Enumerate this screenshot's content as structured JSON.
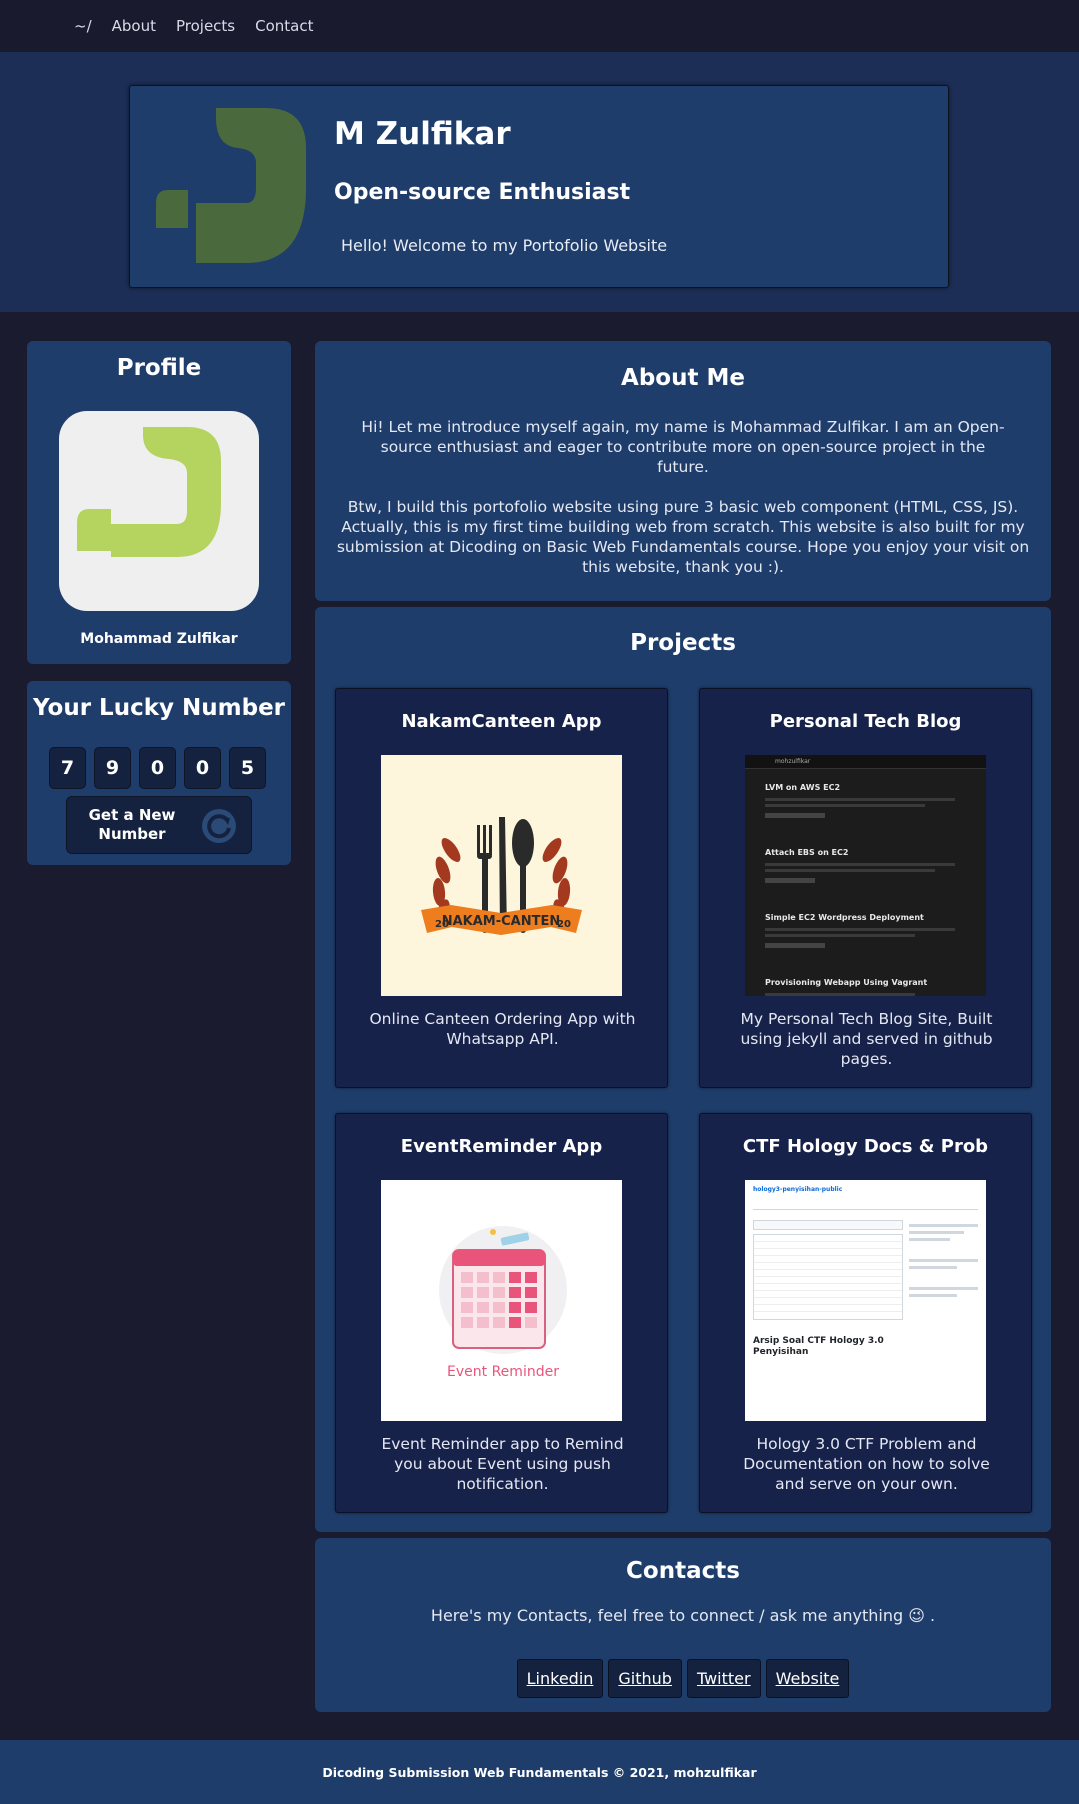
{
  "nav": {
    "home": "~/",
    "about": "About",
    "projects": "Projects",
    "contact": "Contact"
  },
  "hero": {
    "name": "M Zulfikar",
    "subtitle": "Open-source Enthusiast",
    "message": "Hello! Welcome to my Portofolio Website"
  },
  "profile": {
    "title": "Profile",
    "name": "Mohammad Zulfikar"
  },
  "lucky": {
    "title": "Your Lucky Number",
    "digits": [
      "7",
      "9",
      "0",
      "0",
      "5"
    ],
    "button_label": "Get a New Number"
  },
  "about": {
    "title": "About Me",
    "p1": "Hi! Let me introduce myself again, my name is Mohammad Zulfikar. I am an Open-source enthusiast and eager to contribute more on open-source project in the future.",
    "p2": "Btw, I build this portofolio website using pure 3 basic web component (HTML, CSS, JS). Actually, this is my first time building web from scratch. This website is also built for my submission at Dicoding on Basic Web Fundamentals course. Hope you enjoy your visit on this website, thank you :)."
  },
  "projects": {
    "title": "Projects",
    "items": [
      {
        "title": "NakamCanteen App",
        "desc": "Online Canteen Ordering App with Whatsapp API.",
        "image_text": "NAKAM-CANTEN",
        "image_year_left": "20",
        "image_year_right": "20"
      },
      {
        "title": "Personal Tech Blog",
        "desc": "My Personal Tech Blog Site, Built using jekyll and served in github pages.",
        "image_header": "mohzulfikar",
        "image_posts": [
          "LVM on AWS EC2",
          "Attach EBS on EC2",
          "Simple EC2 Wordpress Deployment",
          "Provisioning Webapp Using Vagrant"
        ]
      },
      {
        "title": "EventReminder App",
        "desc": "Event Reminder app to Remind you about Event using push notification.",
        "image_text": "Event Reminder"
      },
      {
        "title": "CTF Hology Docs & Prob",
        "desc": "Hology 3.0 CTF Problem and Documentation on how to solve and serve on your own.",
        "image_repo": "hology3-penyisihan-public",
        "image_readme": "Arsip Soal CTF Hology 3.0 Penyisihan"
      }
    ]
  },
  "contacts": {
    "title": "Contacts",
    "message": "Here's my Contacts, feel free to connect / ask me anything 😉 .",
    "links": [
      "Linkedin",
      "Github",
      "Twitter",
      "Website"
    ]
  },
  "footer": {
    "text": "Dicoding Submission Web Fundamentals © 2021, mohzulfikar"
  },
  "colors": {
    "background": "#1b1b30",
    "panel": "#1f3d6b",
    "card": "#17224a",
    "logo_green": "#b5d35f",
    "logo_dark_green": "#4a6a3e"
  }
}
